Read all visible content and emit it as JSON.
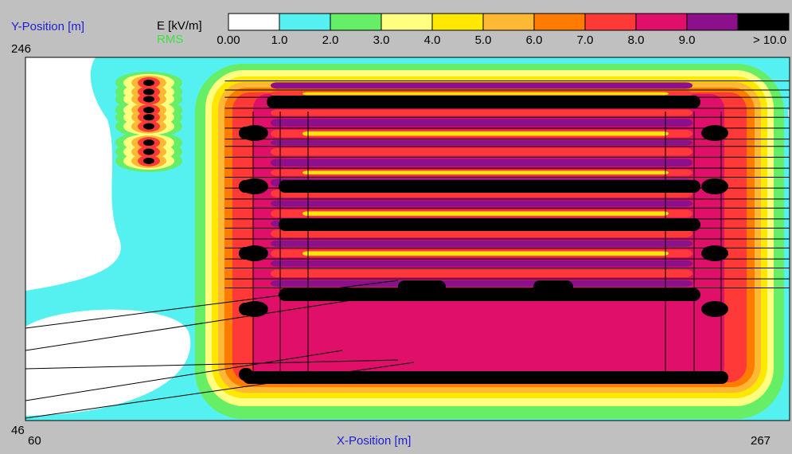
{
  "labels": {
    "y_axis": "Y-Position [m]",
    "x_axis": "X-Position [m]",
    "quantity": "E [kV/m]",
    "rms": "RMS",
    "y_max": "246",
    "y_min": "46",
    "x_min": "60",
    "x_max": "267"
  },
  "colors": {
    "axis_label": "#1f1fd0",
    "rms": "#40e040",
    "background": "#c0c0c0"
  },
  "chart_data": {
    "type": "heatmap",
    "title": "",
    "xlabel": "X-Position [m]",
    "ylabel": "Y-Position [m]",
    "xlim": [
      60,
      267
    ],
    "ylim": [
      46,
      246
    ],
    "colorbar": {
      "label": "E [kV/m]",
      "ticks": [
        "0.00",
        "1.0",
        "2.0",
        "3.0",
        "4.0",
        "5.0",
        "6.0",
        "7.0",
        "8.0",
        "9.0",
        "> 10.0"
      ],
      "colors": [
        "#ffffff",
        "#55f0f0",
        "#66ee66",
        "#ffff80",
        "#ffe800",
        "#ffb833",
        "#ff7c00",
        "#ff3838",
        "#e0106a",
        "#8c0f8c",
        "#000000"
      ]
    },
    "conductor_rows_y": [
      233,
      228,
      224,
      218,
      213,
      207,
      201,
      197,
      191,
      185,
      180,
      174,
      168,
      163,
      157,
      152,
      146,
      141,
      135,
      130,
      124,
      119
    ],
    "left_cluster_rows_y": [
      232,
      227,
      223,
      217,
      213,
      208,
      199,
      194,
      189
    ],
    "x_extent": {
      "cluster": [
        92,
        100
      ],
      "main": [
        114,
        250
      ],
      "rows_from": [
        107,
        258
      ]
    },
    "field_level_description": "Strong field (>10 kV/m) along conductor rows between x≈120 and x≈250; 7–10 kV/m in interior; 0–2 kV/m at left edge"
  }
}
